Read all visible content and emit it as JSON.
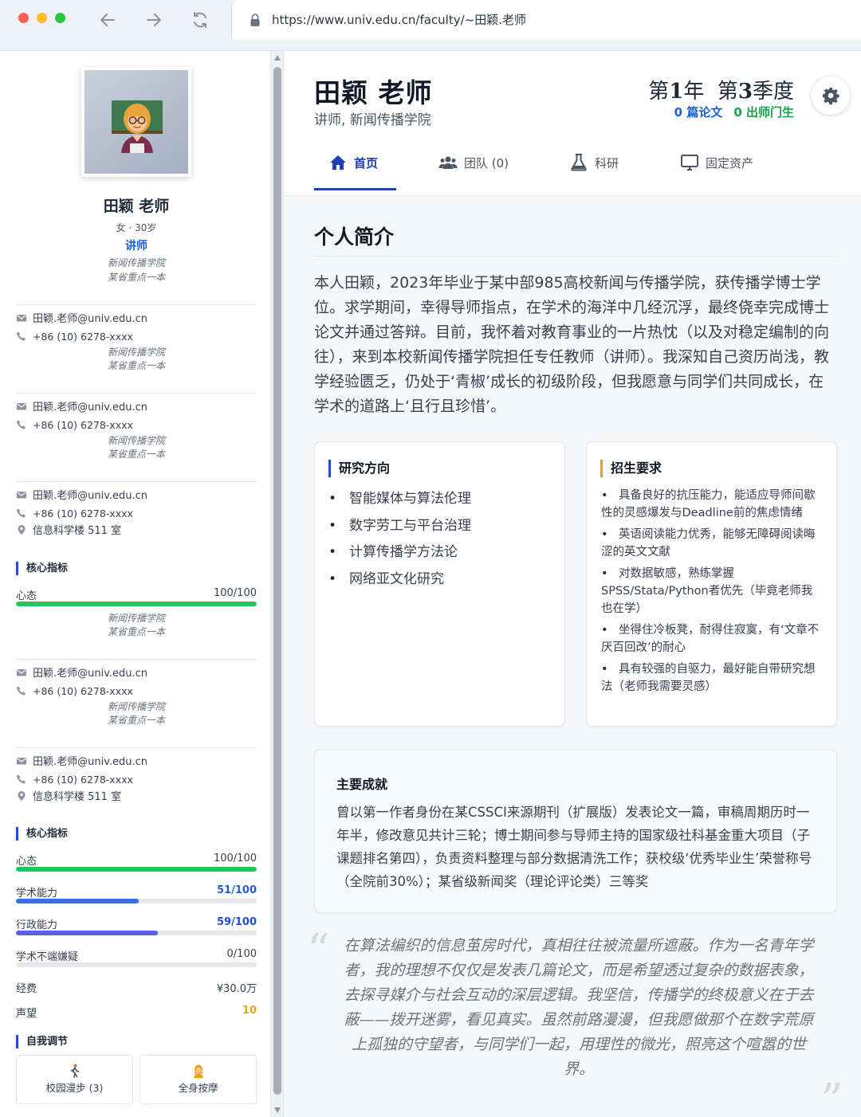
{
  "browser": {
    "url": "https://www.univ.edu.cn/faculty/~田颖.老师",
    "colors": {
      "close": "#ff5f57",
      "minimize": "#febc2e",
      "maximize": "#28c840"
    }
  },
  "sidebar": {
    "name": "田颖 老师",
    "meta": "女 · 30岁",
    "rank": "讲师",
    "dept": "新闻传播学院",
    "tier": "某省重点一本",
    "contact_blocks": [
      {
        "email": "田颖.老师@univ.edu.cn",
        "phone": "+86 (10) 6278-xxxx",
        "dept": "新闻传播学院",
        "tier": "某省重点一本"
      },
      {
        "email": "田颖.老师@univ.edu.cn",
        "phone": "+86 (10) 6278-xxxx",
        "dept": "新闻传播学院",
        "tier": "某省重点一本"
      },
      {
        "email": "田颖.老师@univ.edu.cn",
        "phone": "+86 (10) 6278-xxxx",
        "office": "信息科学楼 511 室"
      },
      {
        "email": "田颖.老师@univ.edu.cn",
        "phone": "+86 (10) 6278-xxxx",
        "dept": "新闻传播学院",
        "tier": "某省重点一本"
      },
      {
        "email": "田颖.老师@univ.edu.cn",
        "phone": "+86 (10) 6278-xxxx",
        "office": "信息科学楼 511 室"
      }
    ],
    "metrics_title": "核心指标",
    "metrics_a": [
      {
        "label": "心态",
        "value": "100/100",
        "fraction": 1.0,
        "color": "#22c55e"
      }
    ],
    "metrics_a_dept": "新闻传播学院",
    "metrics_a_tier": "某省重点一本",
    "metrics_b": [
      {
        "label": "心态",
        "value": "100/100",
        "fraction": 1.0,
        "color": "#22c55e"
      },
      {
        "label": "学术能力",
        "value": "51/100",
        "fraction": 0.51,
        "color": "#3b6fe0",
        "value_color": "#1d5fd6"
      },
      {
        "label": "行政能力",
        "value": "59/100",
        "fraction": 0.59,
        "color": "#5b5fe0",
        "value_color": "#1d4ed8"
      },
      {
        "label": "学术不端嫌疑",
        "value": "0/100",
        "fraction": 0.0,
        "color": "#9ca3af"
      }
    ],
    "funds_label": "经费",
    "funds_value": "¥30.0万",
    "reputation_label": "声望",
    "reputation_value": "10",
    "reputation_color": "#f59e0b",
    "adjust_title": "自我调节",
    "adjust_actions": [
      {
        "label": "校园漫步 (3)",
        "icon": "walking-person-icon"
      },
      {
        "label": "全身按摩",
        "icon": "massage-person-icon"
      }
    ]
  },
  "header": {
    "name": "田颖 老师",
    "title": "讲师, 新闻传播学院",
    "year_prefix": "第",
    "year_num": "1",
    "year_suffix": "年",
    "season_prefix": "第",
    "season_num": "3",
    "season_suffix": "季度",
    "papers": "0 篇论文",
    "students": "0 出师门生",
    "tabs": [
      {
        "label": "首页",
        "icon": "home-icon",
        "active": true
      },
      {
        "label": "团队 (0)",
        "icon": "team-icon"
      },
      {
        "label": "科研",
        "icon": "flask-icon"
      },
      {
        "label": "固定资产",
        "icon": "monitor-icon"
      }
    ]
  },
  "intro": {
    "title": "个人简介",
    "text": "本人田颖，2023年毕业于某中部985高校新闻与传播学院，获传播学博士学位。求学期间，幸得导师指点，在学术的海洋中几经沉浮，最终侥幸完成博士论文并通过答辩。目前，我怀着对教育事业的一片热忱（以及对稳定编制的向往），来到本校新闻传播学院担任专任教师（讲师）。我深知自己资历尚浅，教学经验匮乏，仍处于‘青椒’成长的初级阶段，但我愿意与同学们共同成长，在学术的道路上‘且行且珍惜’。"
  },
  "research": {
    "title": "研究方向",
    "items": [
      "智能媒体与算法伦理",
      "数字劳工与平台治理",
      "计算传播学方法论",
      "网络亚文化研究"
    ]
  },
  "enrollment": {
    "title": "招生要求",
    "items": [
      "具备良好的抗压能力，能适应导师间歇性的灵感爆发与Deadline前的焦虑情绪",
      "英语阅读能力优秀，能够无障碍阅读晦涩的英文文献",
      "对数据敏感，熟练掌握SPSS/Stata/Python者优先（毕竟老师我也在学）",
      "坐得住冷板凳，耐得住寂寞，有‘文章不厌百回改’的耐心",
      "具有较强的自驱力，最好能自带研究想法（老师我需要灵感）"
    ]
  },
  "achievements": {
    "title": "主要成就",
    "text": "曾以第一作者身份在某CSSCI来源期刊（扩展版）发表论文一篇，审稿周期历时一年半，修改意见共计三轮；博士期间参与导师主持的国家级社科基金重大项目（子课题排名第四），负责资料整理与部分数据清洗工作；获校级‘优秀毕业生’荣誉称号（全院前30%）；某省级新闻奖（理论评论类）三等奖"
  },
  "motto": {
    "open_mark": "“",
    "close_mark": "”",
    "text": "在算法编织的信息茧房时代，真相往往被流量所遮蔽。作为一名青年学者，我的理想不仅仅是发表几篇论文，而是希望透过复杂的数据表象，去探寻媒介与社会互动的深层逻辑。我坚信，传播学的终极意义在于去蔽——拨开迷雾，看见真实。虽然前路漫漫，但我愿做那个在数字荒原上孤独的守望者，与同学们一起，用理性的微光，照亮这个喧嚣的世界。"
  }
}
